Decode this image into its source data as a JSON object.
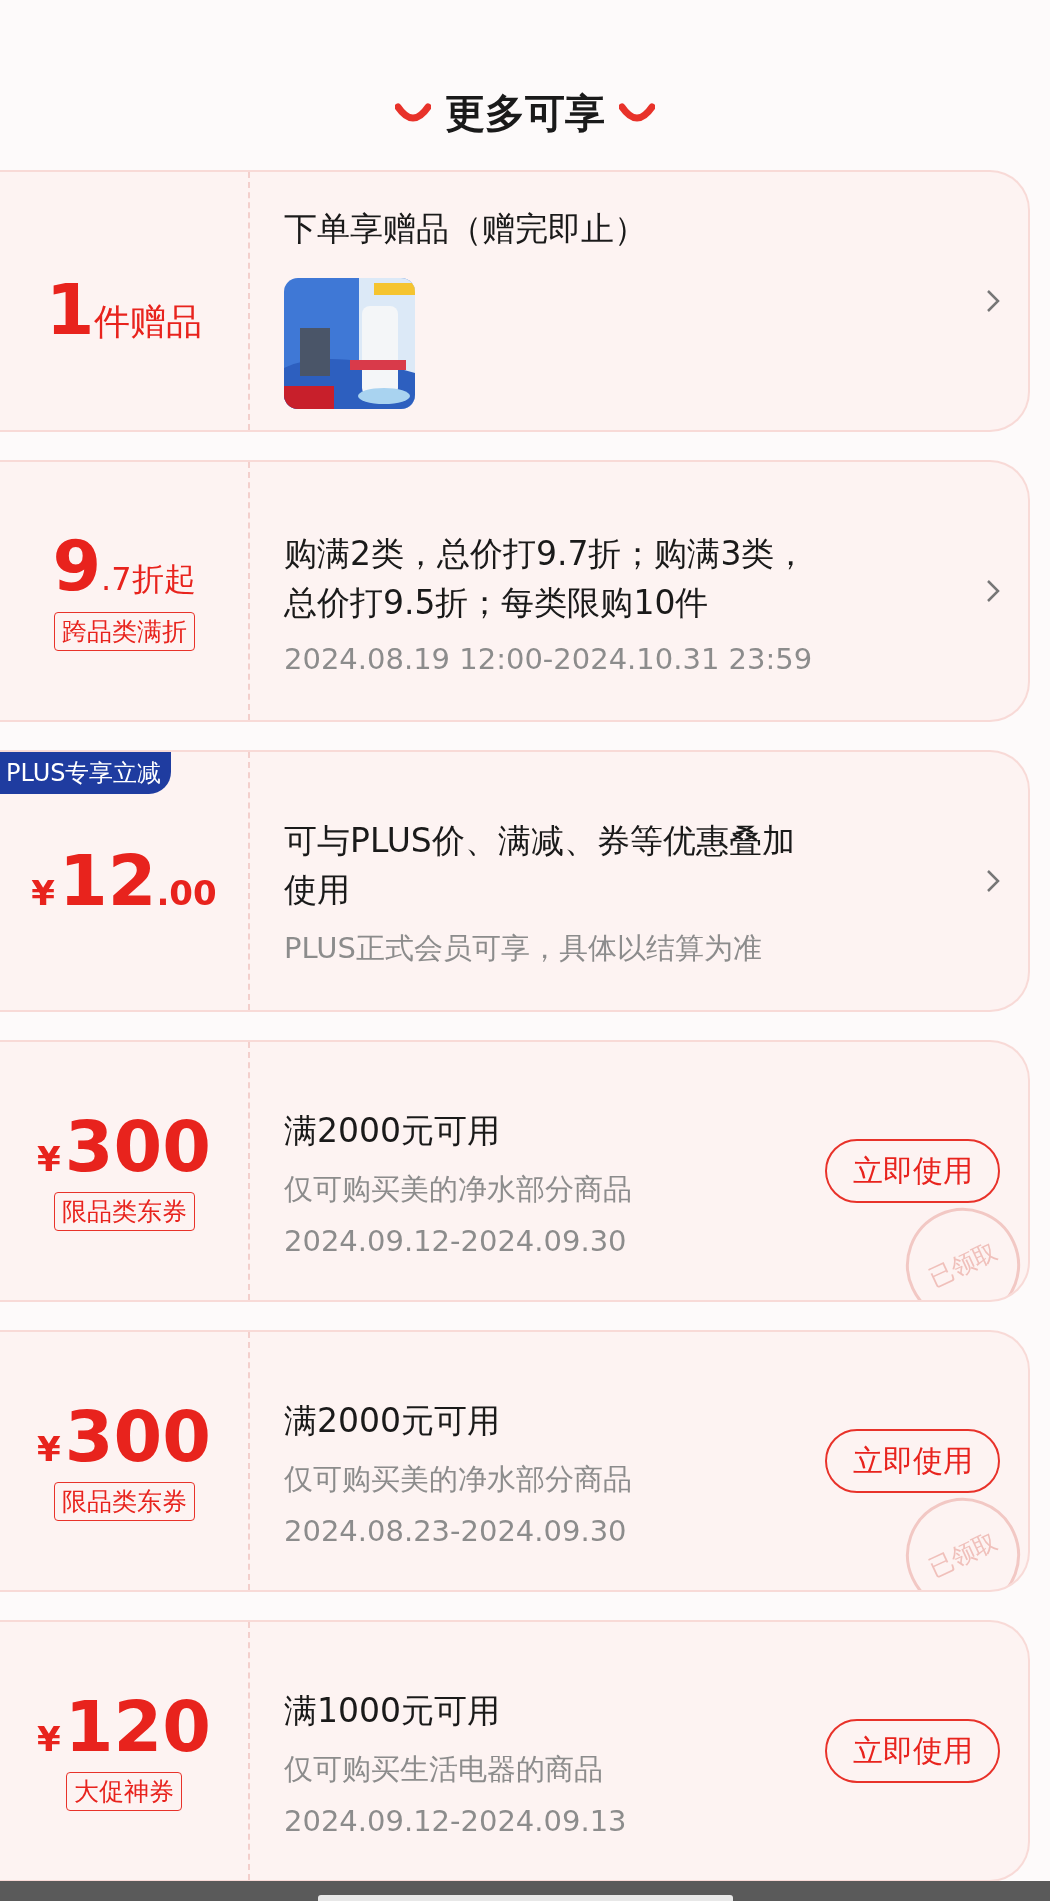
{
  "section_title": "更多可享",
  "cards": [
    {
      "kind": "gift",
      "amount": "1",
      "unit": "件赠品",
      "title": "下单享赠品（赠完即止）",
      "action": {
        "kind": "chevron"
      }
    },
    {
      "kind": "discount",
      "amount": "9",
      "unit": ".7折起",
      "tag": "跨品类满折",
      "title": "购满2类，总价打9.7折；购满3类，总价打9.5折；每类限购10件",
      "date": "2024.08.19 12:00-2024.10.31 23:59",
      "action": {
        "kind": "chevron"
      }
    },
    {
      "kind": "plus",
      "badge": "PLUS专享立减",
      "currency": "¥",
      "amount": "12",
      "unit": ".00",
      "title": "可与PLUS价、满减、券等优惠叠加使用",
      "note": "PLUS正式会员可享，具体以结算为准",
      "action": {
        "kind": "chevron"
      }
    },
    {
      "kind": "coupon",
      "currency": "¥",
      "amount": "300",
      "tag": "限品类东券",
      "title": "满2000元可用",
      "note": "仅可购买美的净水部分商品",
      "date": "2024.09.12-2024.09.30",
      "action": {
        "kind": "button",
        "label": "立即使用"
      },
      "stamp": "已领取"
    },
    {
      "kind": "coupon",
      "currency": "¥",
      "amount": "300",
      "tag": "限品类东券",
      "title": "满2000元可用",
      "note": "仅可购买美的净水部分商品",
      "date": "2024.08.23-2024.09.30",
      "action": {
        "kind": "button",
        "label": "立即使用"
      },
      "stamp": "已领取"
    },
    {
      "kind": "coupon",
      "currency": "¥",
      "amount": "120",
      "tag": "大促神券",
      "title": "满1000元可用",
      "note": "仅可购买生活电器的商品",
      "date": "2024.09.12-2024.09.13",
      "action": {
        "kind": "button",
        "label": "立即使用"
      }
    }
  ]
}
